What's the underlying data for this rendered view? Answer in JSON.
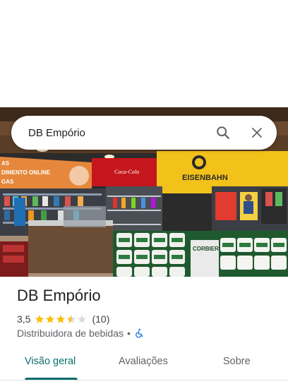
{
  "search": {
    "query": "DB Empório"
  },
  "photo": {
    "signs": {
      "eisenbahn": "EISENBAHN",
      "coca_cola": "Coca-Cola",
      "promo_line1": "AS",
      "promo_line2": "DIMENTO ONLINE",
      "promo_line3": "GAS",
      "corbier": "CORBIER"
    }
  },
  "place": {
    "name": "DB Empório",
    "rating": "3,5",
    "rating_fraction": 0.7,
    "review_count": "(10)",
    "category": "Distribuidora de bebidas",
    "separator": "•"
  },
  "tabs": [
    {
      "label": "Visão geral",
      "active": true
    },
    {
      "label": "Avaliações",
      "active": false
    },
    {
      "label": "Sobre",
      "active": false
    }
  ],
  "colors": {
    "accent": "#0b6e6e",
    "star": "#fbbc04",
    "star_empty": "#dadce0",
    "accessibility": "#1a73e8"
  },
  "icons": {
    "search": "search-icon",
    "close": "close-icon",
    "accessibility": "wheelchair-icon",
    "star": "star-icon"
  }
}
